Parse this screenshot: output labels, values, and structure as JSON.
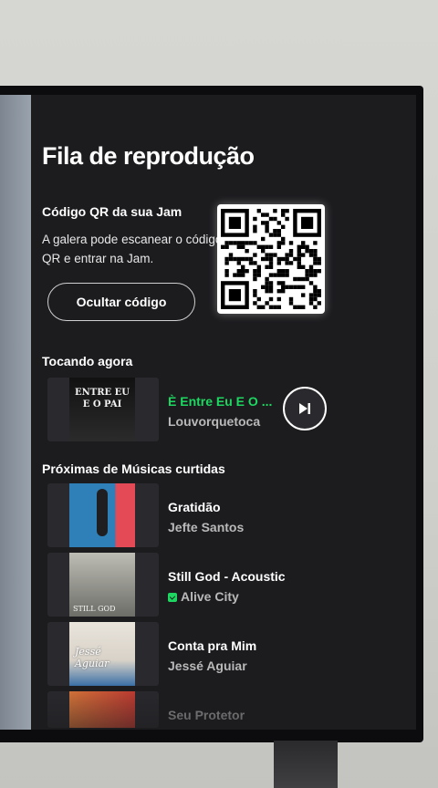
{
  "queue": {
    "title": "Fila de reprodução",
    "qr": {
      "heading": "Código QR da sua Jam",
      "description": "A galera pode escanear o código QR e entrar na Jam.",
      "hide_button": "Ocultar código"
    },
    "now_playing": {
      "label": "Tocando agora",
      "track": {
        "title": "È Entre Eu E O ...",
        "artist": "Louvorquetoca",
        "cover_text": "ENTRE EU E O PAI"
      },
      "skip_icon": "skip-next-icon"
    },
    "next_up": {
      "label": "Próximas de Músicas curtidas",
      "tracks": [
        {
          "title": "Gratidão",
          "artist": "Jefte Santos",
          "downloaded": false,
          "cover_colors": [
            "#2f7fb8",
            "#e44a55"
          ]
        },
        {
          "title": "Still God - Acoustic",
          "artist": "Alive City",
          "downloaded": true,
          "cover_colors": [
            "#6d6d68",
            "#bdbdb5"
          ],
          "cover_text": "STILL GOD"
        },
        {
          "title": "Conta pra Mim",
          "artist": "Jessé Aguiar",
          "downloaded": false,
          "cover_colors": [
            "#e9e4dc",
            "#3b6fa6"
          ],
          "cover_text": "Jessé Aguiar"
        },
        {
          "title": "Seu Protetor",
          "artist": "",
          "downloaded": false,
          "cover_colors": [
            "#e27a3b",
            "#c93d33"
          ]
        }
      ]
    }
  },
  "colors": {
    "accent": "#1ed760",
    "panel": "#1c1c1f",
    "text": "#ffffff",
    "muted": "#b9b9b9"
  }
}
